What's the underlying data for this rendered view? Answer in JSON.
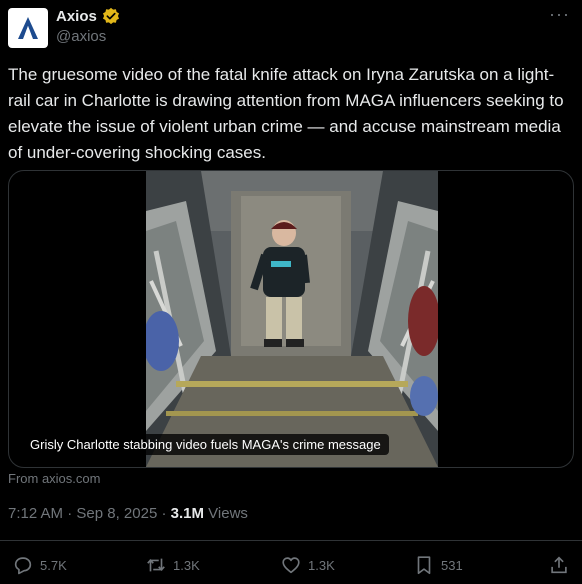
{
  "author": {
    "display_name": "Axios",
    "handle": "@axios",
    "avatar_icon": "axios-logo-icon",
    "verified_icon": "verified-gold-badge-icon",
    "verified_color": "#e2b719"
  },
  "tweet": {
    "text": "The gruesome video of the fatal knife attack on Iryna Zarutska on a light-rail car in Charlotte is drawing attention from MAGA influencers seeking to elevate the issue of violent urban crime — and accuse mainstream media of under-covering shocking cases."
  },
  "card": {
    "caption": "Grisly Charlotte stabbing video fuels MAGA's crime message",
    "source": "From axios.com"
  },
  "meta": {
    "time": "7:12 AM",
    "separator": "·",
    "date": "Sep 8, 2025",
    "views_count": "3.1M",
    "views_label": "Views"
  },
  "actions": {
    "replies": "5.7K",
    "reposts": "1.3K",
    "likes": "1.3K",
    "bookmarks": "531"
  },
  "colors": {
    "background": "#000000",
    "text_primary": "#e7e9ea",
    "text_secondary": "#71767b",
    "border": "#2f3336"
  }
}
